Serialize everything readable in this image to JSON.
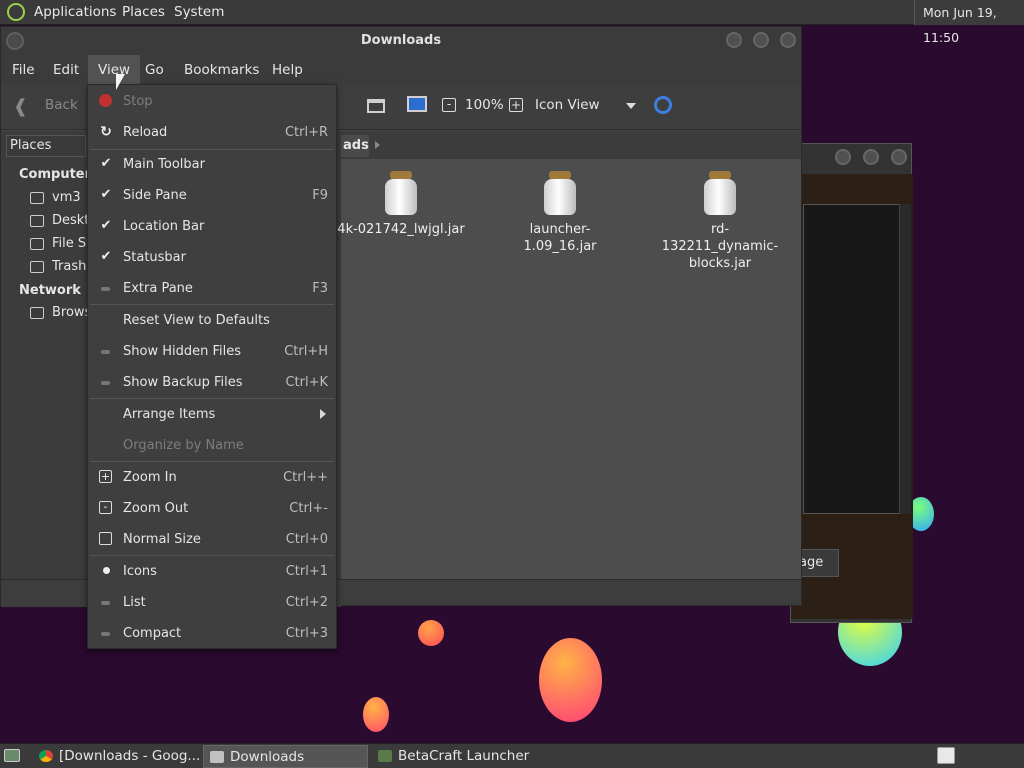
{
  "top_panel": {
    "menus": [
      "Applications",
      "Places",
      "System"
    ],
    "clock": "Mon Jun 19, 11:50"
  },
  "window": {
    "title": "Downloads",
    "menubar": [
      "File",
      "Edit",
      "View",
      "Go",
      "Bookmarks",
      "Help"
    ],
    "toolbar": {
      "back": "Back",
      "zoom": "100%",
      "view_mode": "Icon View"
    },
    "sidepane": {
      "header": "Places",
      "computer": "Computer",
      "items": [
        "vm3",
        "Deskto",
        "File Sy",
        "Trash"
      ],
      "network": "Network",
      "network_items": [
        "Brows"
      ]
    },
    "location": {
      "crumb": "ads"
    },
    "files": [
      {
        "name": "4k-021742_lwjgl.jar"
      },
      {
        "name": "launcher-1.09_16.jar"
      },
      {
        "name": "rd-132211_dynamic-blocks.jar"
      }
    ]
  },
  "back_window": {
    "button": "age"
  },
  "view_menu": {
    "items": [
      {
        "label": "Stop",
        "accel": "",
        "icon": "stop-icon",
        "disabled": true
      },
      {
        "label": "Reload",
        "accel": "Ctrl+R",
        "icon": "reload-icon"
      },
      {
        "label": "Main Toolbar",
        "accel": "",
        "icon": "check-icon"
      },
      {
        "label": "Side Pane",
        "accel": "F9",
        "icon": "check-icon"
      },
      {
        "label": "Location Bar",
        "accel": "",
        "icon": "check-icon"
      },
      {
        "label": "Statusbar",
        "accel": "",
        "icon": "check-icon"
      },
      {
        "label": "Extra Pane",
        "accel": "F3",
        "icon": "unchecked-icon"
      },
      {
        "label": "Reset View to Defaults",
        "accel": ""
      },
      {
        "label": "Show Hidden Files",
        "accel": "Ctrl+H",
        "icon": "unchecked-icon"
      },
      {
        "label": "Show Backup Files",
        "accel": "Ctrl+K",
        "icon": "unchecked-icon"
      },
      {
        "label": "Arrange Items",
        "accel": "",
        "submenu": true
      },
      {
        "label": "Organize by Name",
        "accel": "",
        "disabled": true
      },
      {
        "label": "Zoom In",
        "accel": "Ctrl++",
        "icon": "zoom-in-icon"
      },
      {
        "label": "Zoom Out",
        "accel": "Ctrl+-",
        "icon": "zoom-out-icon"
      },
      {
        "label": "Normal Size",
        "accel": "Ctrl+0",
        "icon": "zoom-normal-icon"
      },
      {
        "label": "Icons",
        "accel": "Ctrl+1",
        "icon": "radio-selected-icon"
      },
      {
        "label": "List",
        "accel": "Ctrl+2",
        "icon": "radio-unselected-icon"
      },
      {
        "label": "Compact",
        "accel": "Ctrl+3",
        "icon": "radio-unselected-icon"
      }
    ]
  },
  "taskbar": {
    "tasks": [
      "[Downloads - Goog...",
      "Downloads",
      "BetaCraft Launcher ..."
    ]
  }
}
